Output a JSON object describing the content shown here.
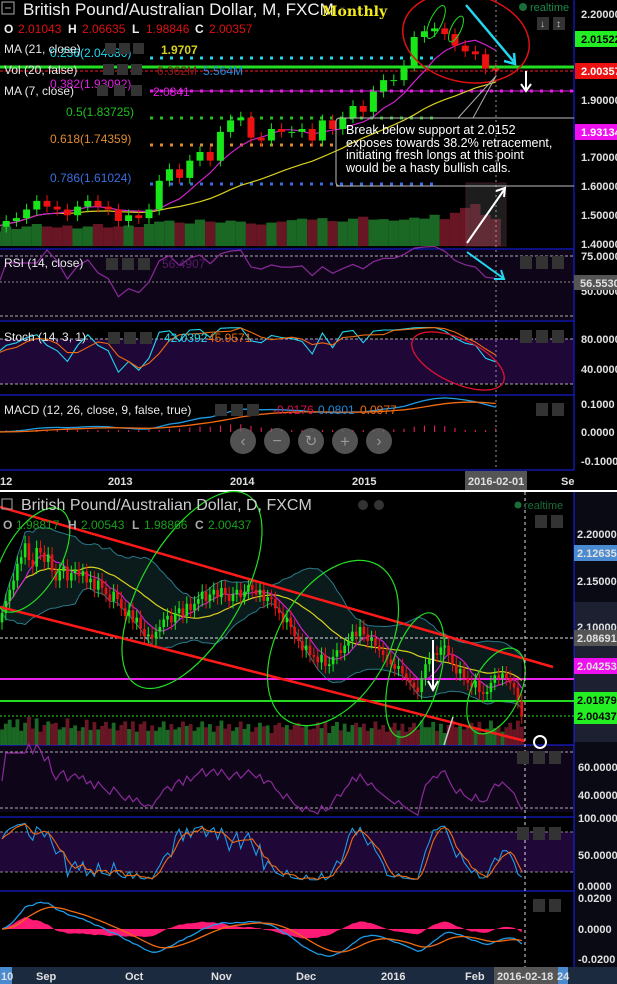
{
  "top_chart": {
    "title": "British Pound/Australian Dollar, M, FXCM",
    "stamp": "Monthly",
    "realtime": "realtime",
    "ohlc": {
      "o_label": "O",
      "o": "2.01043",
      "h_label": "H",
      "h": "2.06635",
      "l_label": "L",
      "l": "1.98846",
      "c_label": "C",
      "c": "2.00357"
    },
    "indicators": {
      "ma21_label": "MA (21, close)",
      "ma21_value": "1.9707",
      "vol_label": "Vol (20, false)",
      "vol_value1": "6.362M",
      "vol_value2": "5.564M",
      "ma7_label": "MA (7, close)",
      "ma7_value": "2.0841"
    },
    "fib": {
      "f236": "0.236(2.04680)",
      "f382": "0.382(1.93092)",
      "f5": "0.5(1.83725)",
      "f618": "0.618(1.74359)",
      "f786": "0.786(1.61024)"
    },
    "callout": [
      "Break below support at 2.0152",
      "exposes towards 38.2% retracement,",
      "initiating fresh longs at this point",
      "would be a hasty bullish calls."
    ],
    "price_axis": [
      "2.20000",
      "1.90000",
      "1.70000",
      "1.60000",
      "1.50000",
      "1.40000"
    ],
    "badges": {
      "green": "2.01522",
      "red": "2.00357",
      "magenta": "1.93134"
    },
    "rsi": {
      "label": "RSI (14, close)",
      "value": "56.4907",
      "axis": [
        "75.0000",
        "50.0000"
      ],
      "badge": "56.5530"
    },
    "stoch": {
      "label": "Stoch (14, 3, 1)",
      "k": "42.0392",
      "d": "45.9571",
      "axis": [
        "80.0000",
        "40.0000"
      ]
    },
    "macd": {
      "label": "MACD (12, 26, close, 9, false, true)",
      "hist": "-0.0176",
      "macd": "0.0801",
      "signal": "0.0977",
      "axis": [
        "0.1000",
        "0.0000",
        "-0.1000"
      ]
    },
    "time_axis": [
      "12",
      "2013",
      "2014",
      "2015",
      "Se"
    ],
    "cursor_date": "2016-02-01",
    "nav": {
      "prev": "‹",
      "zoom_out": "−",
      "reset": "↻",
      "zoom_in": "+",
      "next": "›"
    }
  },
  "bottom_chart": {
    "title": "British Pound/Australian Dollar, D, FXCM",
    "realtime": "realtime",
    "ohlc": {
      "o_label": "O",
      "o": "1.98817",
      "h_label": "H",
      "h": "2.00543",
      "l_label": "L",
      "l": "1.98866",
      "c_label": "C",
      "c": "2.00437"
    },
    "price_axis": [
      "2.20000",
      "2.15000",
      "2.10000"
    ],
    "badges": {
      "blue": "2.12635",
      "grey": "2.08691",
      "magenta": "2.04253",
      "green1": "2.01879",
      "green2": "2.00437"
    },
    "rsi_axis": [
      "60.0000",
      "40.0000"
    ],
    "stoch_axis": [
      "100.0000",
      "50.0000",
      "0.0000"
    ],
    "macd_axis": [
      "0.0200",
      "0.0000",
      "-0.0200"
    ],
    "time_axis": [
      "10",
      "Sep",
      "Oct",
      "Nov",
      "Dec",
      "2016",
      "Feb",
      "24"
    ],
    "cursor_date": "2016-02-18"
  },
  "colors": {
    "up": "#19e619",
    "down": "#ee1111",
    "ma7": "#cc22cc",
    "ma21": "#d8d020",
    "axis": "#1a22ff",
    "rsi": "#8a2a9a",
    "stoch_k": "#1e9be6",
    "stoch_d": "#f06a10",
    "macd_hist": "#ff1a75"
  },
  "chart_data": [
    {
      "type": "candlestick",
      "title": "British Pound/Australian Dollar, M, FXCM",
      "period": "monthly",
      "x_range": [
        "2012-01",
        "2016-02"
      ],
      "first_open": 1.45,
      "closes": [
        1.46,
        1.48,
        1.49,
        1.52,
        1.55,
        1.53,
        1.52,
        1.5,
        1.53,
        1.55,
        1.53,
        1.52,
        1.48,
        1.5,
        1.49,
        1.52,
        1.62,
        1.66,
        1.63,
        1.69,
        1.72,
        1.69,
        1.79,
        1.83,
        1.84,
        1.77,
        1.76,
        1.8,
        1.79,
        1.79,
        1.8,
        1.76,
        1.83,
        1.8,
        1.84,
        1.88,
        1.86,
        1.93,
        1.97,
        1.97,
        2.02,
        2.12,
        2.14,
        2.15,
        2.13,
        2.09,
        2.07,
        2.06,
        2.01,
        2.00357
      ],
      "volumes": [
        3,
        4,
        3.5,
        4,
        4.5,
        4,
        3.8,
        4.2,
        3.6,
        4,
        4.5,
        3.8,
        4,
        4.2,
        3.9,
        4.5,
        5,
        5.2,
        4.8,
        4.6,
        5.4,
        5.0,
        4.8,
        5.2,
        5,
        4.6,
        4.4,
        4.8,
        5,
        5.3,
        5.6,
        5.4,
        5.7,
        5.1,
        5.0,
        5.6,
        6.0,
        5.4,
        5.5,
        5.2,
        5.4,
        5.8,
        5.6,
        6.4,
        5.5,
        6.8,
        7.8,
        8.6,
        6.36,
        5.56
      ],
      "ylim": [
        1.4,
        2.2
      ]
    },
    {
      "type": "candlestick",
      "title": "British Pound/Australian Dollar, D, FXCM",
      "period": "daily",
      "x_range": [
        "2015-08-10",
        "2016-02-18"
      ],
      "first_open": 2.105,
      "closes": [
        2.115,
        2.128,
        2.14,
        2.15,
        2.168,
        2.175,
        2.19,
        2.172,
        2.165,
        2.185,
        2.18,
        2.17,
        2.178,
        2.16,
        2.15,
        2.16,
        2.165,
        2.15,
        2.158,
        2.162,
        2.155,
        2.16,
        2.148,
        2.152,
        2.14,
        2.15,
        2.142,
        2.135,
        2.128,
        2.138,
        2.13,
        2.12,
        2.112,
        2.118,
        2.105,
        2.11,
        2.098,
        2.09,
        2.092,
        2.088,
        2.095,
        2.1,
        2.108,
        2.112,
        2.105,
        2.115,
        2.12,
        2.112,
        2.125,
        2.118,
        2.125,
        2.13,
        2.138,
        2.128,
        2.135,
        2.14,
        2.132,
        2.142,
        2.135,
        2.128,
        2.135,
        2.14,
        2.132,
        2.138,
        2.145,
        2.14,
        2.135,
        2.14,
        2.128,
        2.132,
        2.13,
        2.12,
        2.115,
        2.105,
        2.11,
        2.1,
        2.09,
        2.085,
        2.075,
        2.08,
        2.07,
        2.068,
        2.062,
        2.07,
        2.058,
        2.06,
        2.068,
        2.075,
        2.072,
        2.08,
        2.085,
        2.095,
        2.09,
        2.1,
        2.092,
        2.085,
        2.088,
        2.08,
        2.075,
        2.07,
        2.065,
        2.06,
        2.055,
        2.058,
        2.05,
        2.045,
        2.04,
        2.035,
        2.03,
        2.045,
        2.06,
        2.065,
        2.072,
        2.07,
        2.078,
        2.08,
        2.07,
        2.06,
        2.05,
        2.055,
        2.045,
        2.04,
        2.035,
        2.042,
        2.03,
        2.028,
        2.03,
        2.04,
        2.048,
        2.045,
        2.05,
        2.045,
        2.04,
        2.035,
        2.02,
        2.004
      ],
      "ylim": [
        2.0,
        2.2
      ]
    }
  ]
}
